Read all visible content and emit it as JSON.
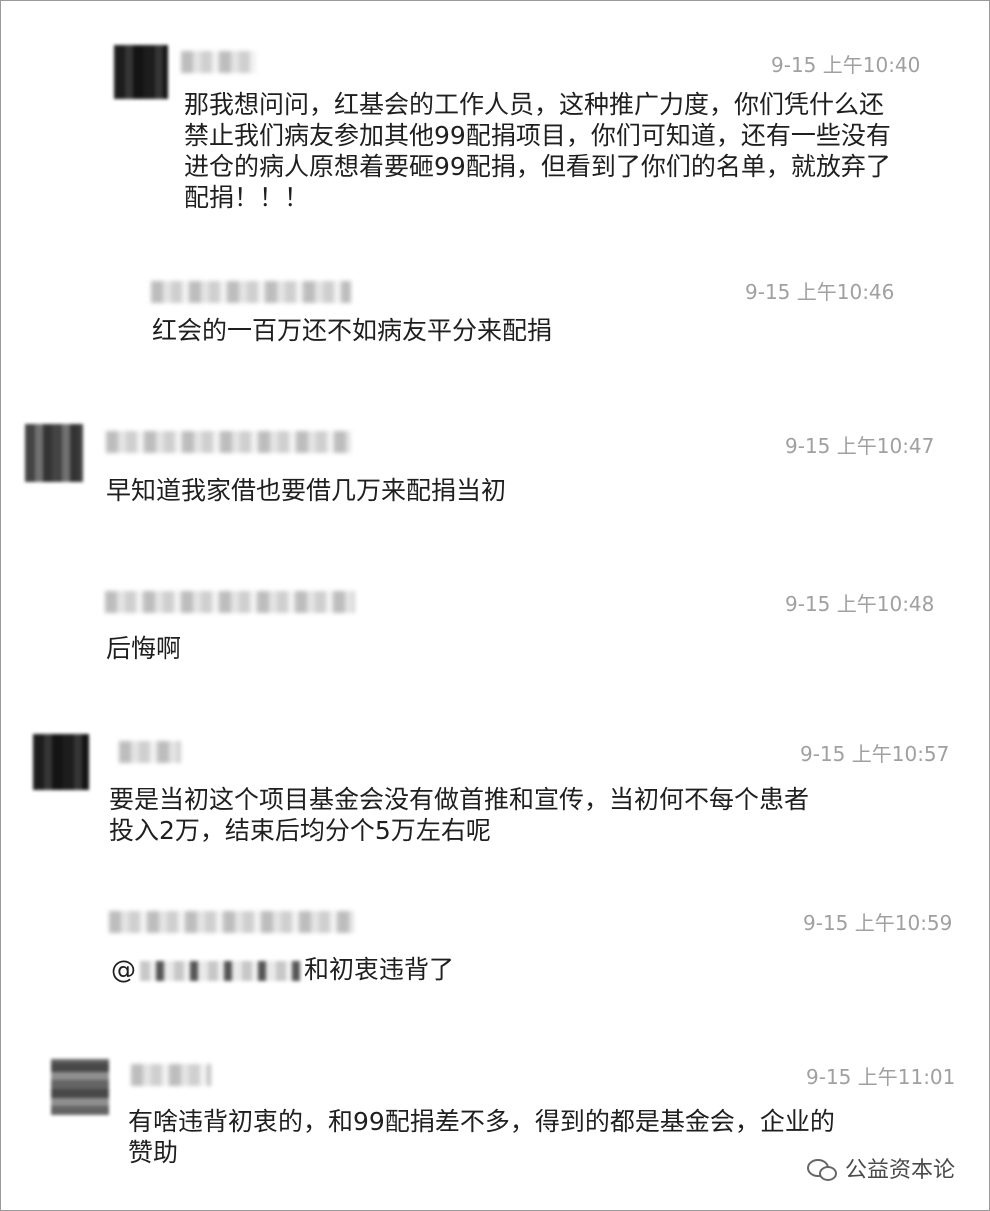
{
  "messages": [
    {
      "time": "9-15 上午10:40",
      "lines": [
        "那我想问问，红基会的工作人员，这种推广力度，你们凭什么还",
        "禁止我们病友参加其他99配捐项目，你们可知道，还有一些没有",
        "进仓的病人原想着要砸99配捐，但看到了你们的名单，就放弃了",
        "配捐！！！"
      ]
    },
    {
      "time": "9-15 上午10:46",
      "lines": [
        "红会的一百万还不如病友平分来配捐"
      ]
    },
    {
      "time": "9-15 上午10:47",
      "lines": [
        "早知道我家借也要借几万来配捐当初"
      ]
    },
    {
      "time": "9-15 上午10:48",
      "lines": [
        "后悔啊"
      ]
    },
    {
      "time": "9-15 上午10:57",
      "lines": [
        "要是当初这个项目基金会没有做首推和宣传，当初何不每个患者",
        "投入2万，结束后均分个5万左右呢"
      ]
    },
    {
      "time": "9-15 上午10:59",
      "prefix": "@",
      "suffix": "和初衷违背了"
    },
    {
      "time": "9-15 上午11:01",
      "lines": [
        "有啥违背初衷的，和99配捐差不多，得到的都是基金会，企业的",
        "赞助"
      ]
    }
  ],
  "watermark": "公益资本论"
}
